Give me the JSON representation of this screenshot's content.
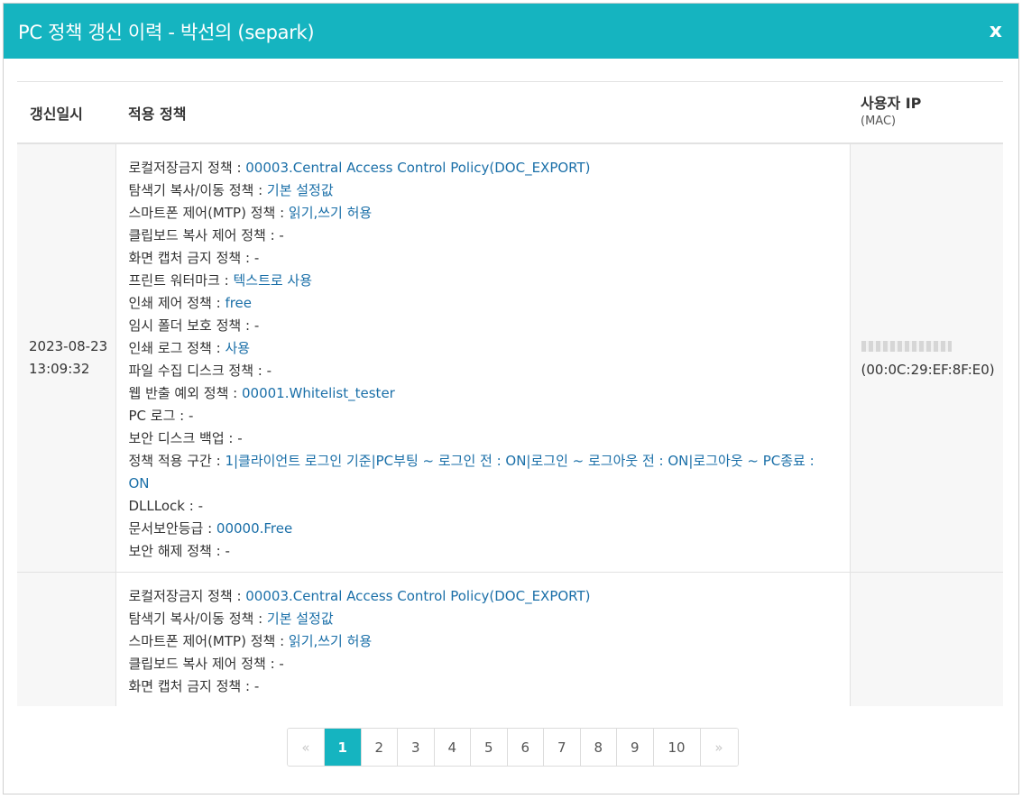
{
  "header": {
    "title": "PC 정책 갱신 이력 - 박선의 (separk)",
    "close_label": "x"
  },
  "table": {
    "columns": {
      "date": "갱신일시",
      "policy": "적용 정책",
      "ip": "사용자 IP",
      "mac_sub": "(MAC)"
    },
    "rows": [
      {
        "date": "2023-08-23 13:09:32",
        "policies": [
          {
            "label": "로컬저장금지 정책",
            "value": "00003.Central Access Control Policy(DOC_EXPORT)"
          },
          {
            "label": "탐색기 복사/이동 정책",
            "value": "기본 설정값"
          },
          {
            "label": "스마트폰 제어(MTP) 정책",
            "value": "읽기,쓰기 허용"
          },
          {
            "label": "클립보드 복사 제어 정책",
            "value": "-"
          },
          {
            "label": "화면 캡처 금지 정책",
            "value": "-"
          },
          {
            "label": "프린트 워터마크",
            "value": "텍스트로 사용"
          },
          {
            "label": "인쇄 제어 정책",
            "value": "free"
          },
          {
            "label": "임시 폴더 보호 정책",
            "value": "-"
          },
          {
            "label": "인쇄 로그 정책",
            "value": "사용"
          },
          {
            "label": "파일 수집 디스크 정책",
            "value": "-"
          },
          {
            "label": "웹 반출 예외 정책",
            "value": "00001.Whitelist_tester"
          },
          {
            "label": "PC 로그",
            "value": "-"
          },
          {
            "label": "보안 디스크 백업",
            "value": "-"
          },
          {
            "label": "정책 적용 구간",
            "value": "1|클라이언트 로그인 기준|PC부팅 ~ 로그인 전 : ON|로그인 ~ 로그아웃 전 : ON|로그아웃 ~ PC종료 : ON"
          },
          {
            "label": "DLLLock",
            "value": "-"
          },
          {
            "label": "문서보안등급",
            "value": "00000.Free"
          },
          {
            "label": "보안 해제 정책",
            "value": "-"
          }
        ],
        "mac": "(00:0C:29:EF:8F:E0)"
      },
      {
        "date": "",
        "policies": [
          {
            "label": "로컬저장금지 정책",
            "value": "00003.Central Access Control Policy(DOC_EXPORT)"
          },
          {
            "label": "탐색기 복사/이동 정책",
            "value": "기본 설정값"
          },
          {
            "label": "스마트폰 제어(MTP) 정책",
            "value": "읽기,쓰기 허용"
          },
          {
            "label": "클립보드 복사 제어 정책",
            "value": "-"
          },
          {
            "label": "화면 캡처 금지 정책",
            "value": "-"
          }
        ],
        "mac": ""
      }
    ]
  },
  "pagination": {
    "prev": "«",
    "next": "»",
    "pages": [
      "1",
      "2",
      "3",
      "4",
      "5",
      "6",
      "7",
      "8",
      "9",
      "10"
    ],
    "current": "1"
  }
}
